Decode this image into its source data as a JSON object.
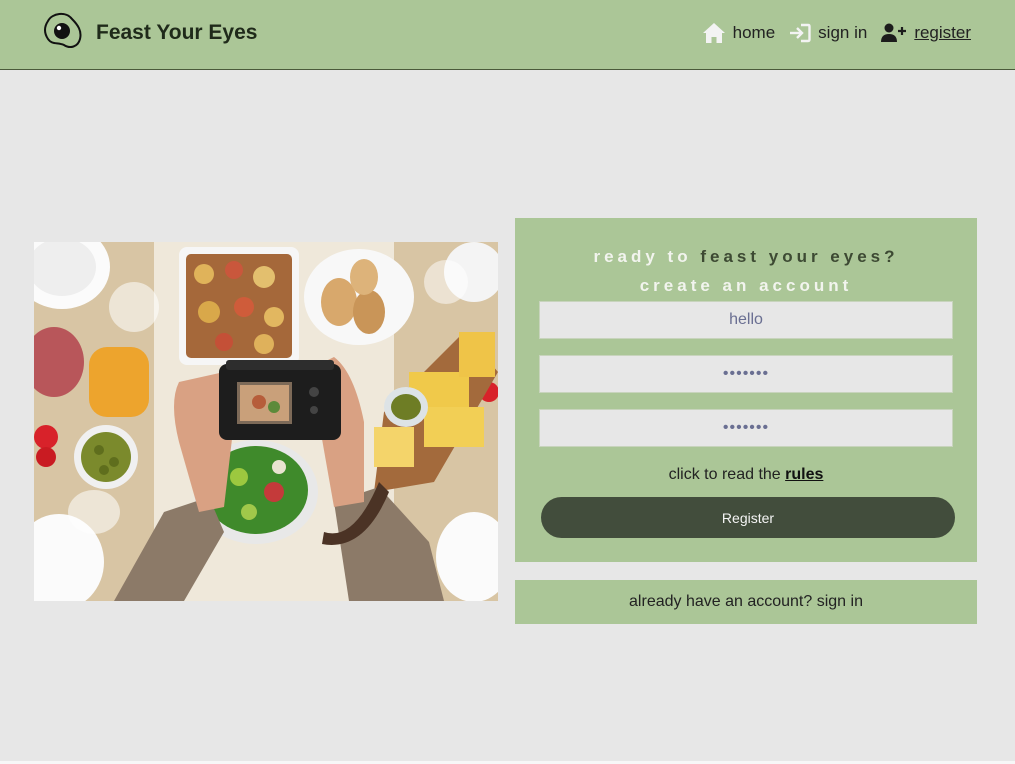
{
  "header": {
    "brand": "Feast Your Eyes",
    "logo_icon": "fried-egg-icon",
    "nav": [
      {
        "label": "home",
        "icon": "home-icon"
      },
      {
        "label": "sign in",
        "icon": "sign-in-icon"
      },
      {
        "label": "register",
        "icon": "add-user-icon",
        "active": true
      }
    ]
  },
  "hero_image": {
    "icon": "food-photography-image"
  },
  "form": {
    "heading_part1": "ready to ",
    "heading_part2": "feast your eyes?",
    "heading_line2": "create an account",
    "username_value": "hello",
    "password_value": "•••••••",
    "confirm_password_value": "•••••••",
    "rules_prefix": "click to read the ",
    "rules_link": "rules",
    "register_button": "Register"
  },
  "signin_prompt": "already have an account? sign in",
  "colors": {
    "background": "#e7e7e7",
    "accent_green": "#abc697",
    "button_dark": "#424d3c"
  }
}
